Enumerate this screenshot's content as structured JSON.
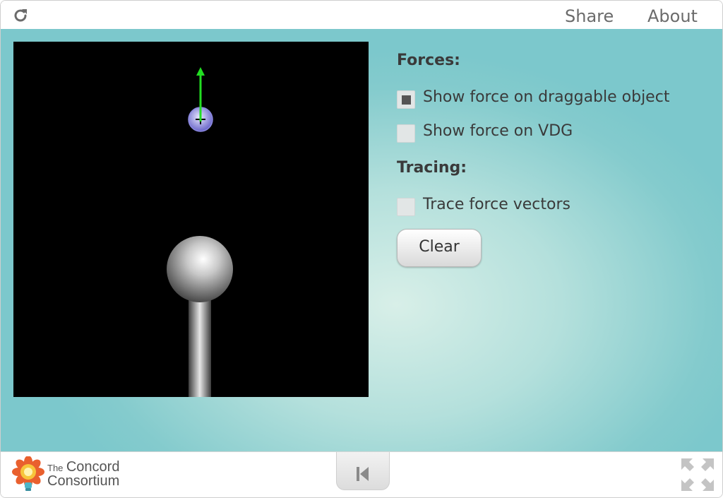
{
  "header": {
    "reload_icon": "reload-icon",
    "share_label": "Share",
    "about_label": "About"
  },
  "controls": {
    "forces_title": "Forces:",
    "show_force_draggable": {
      "label": "Show force on draggable object",
      "checked": true
    },
    "show_force_vdg": {
      "label": "Show force on VDG",
      "checked": false
    },
    "tracing_title": "Tracing:",
    "trace_vectors": {
      "label": "Trace force vectors",
      "checked": false
    },
    "clear_label": "Clear"
  },
  "footer": {
    "brand_line1": "The",
    "brand_line1b": "Concord",
    "brand_line2": "Consortium",
    "back_icon": "skip-back-icon",
    "fullscreen_icon": "fullscreen-icon"
  },
  "colors": {
    "force_arrow": "#22dd22",
    "background_teal": "#7cc8cc"
  }
}
